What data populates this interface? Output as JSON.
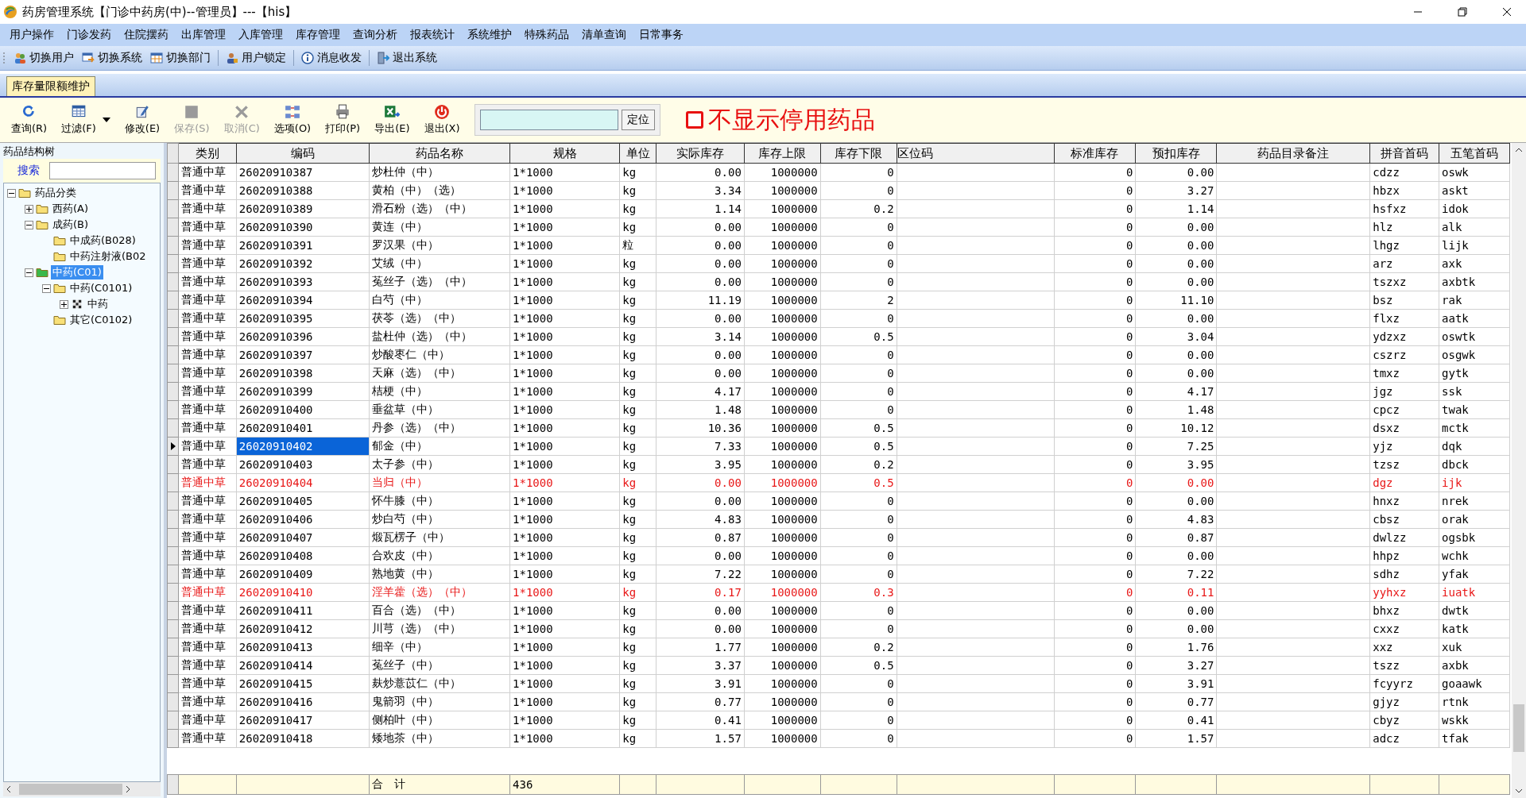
{
  "window": {
    "title": "药房管理系统【门诊中药房(中)--管理员】---【his】"
  },
  "menu": [
    "用户操作",
    "门诊发药",
    "住院摆药",
    "出库管理",
    "入库管理",
    "库存管理",
    "查询分析",
    "报表统计",
    "系统维护",
    "特殊药品",
    "清单查询",
    "日常事务"
  ],
  "toolbar": [
    "切换用户",
    "切换系统",
    "切换部门",
    "用户锁定",
    "消息收发",
    "退出系统"
  ],
  "tabs": [
    {
      "label": "库存量限额维护",
      "selected": true
    }
  ],
  "ribbon": [
    {
      "label": "查询(R)",
      "disabled": false
    },
    {
      "label": "过滤(F)",
      "disabled": false,
      "dropdown": true
    },
    {
      "label": "修改(E)",
      "disabled": false
    },
    {
      "label": "保存(S)",
      "disabled": true
    },
    {
      "label": "取消(C)",
      "disabled": true
    },
    {
      "label": "选项(O)",
      "disabled": false
    },
    {
      "label": "打印(P)",
      "disabled": false
    },
    {
      "label": "导出(E)",
      "disabled": false
    },
    {
      "label": "退出(X)",
      "disabled": false
    }
  ],
  "locate_button": "定位",
  "hide_disabled": {
    "label": "不显示停用药品",
    "checked": false
  },
  "sidebar": {
    "title": "药品结构树",
    "search_label": "搜索",
    "tree": [
      {
        "label": "药品分类",
        "kind": "folder",
        "selected": false,
        "expanded": true,
        "children": [
          {
            "label": "西药(A)",
            "kind": "folder",
            "selected": false,
            "expanded": false
          },
          {
            "label": "成药(B)",
            "kind": "folder",
            "selected": false,
            "expanded": true,
            "children": [
              {
                "label": "中成药(B028)",
                "kind": "folder",
                "selected": false
              },
              {
                "label": "中药注射液(B02",
                "kind": "folder",
                "selected": false
              }
            ]
          },
          {
            "label": "中药(C01)",
            "kind": "folder",
            "selected": true,
            "expanded": true,
            "children": [
              {
                "label": "中药(C0101)",
                "kind": "folder",
                "selected": false,
                "expanded": true,
                "children": [
                  {
                    "label": "中药",
                    "kind": "flag",
                    "selected": false,
                    "expanded": false
                  }
                ]
              },
              {
                "label": "其它(C0102)",
                "kind": "folder",
                "selected": false
              }
            ]
          }
        ]
      }
    ]
  },
  "table": {
    "columns": [
      "类别",
      "编码",
      "药品名称",
      "规格",
      "单位",
      "实际库存",
      "库存上限",
      "库存下限",
      "区位码",
      "标准库存",
      "预扣库存",
      "药品目录备注",
      "拼音首码",
      "五笔首码"
    ],
    "rows": [
      {
        "category": "普通中草",
        "code": "26020910387",
        "name": "炒杜仲（中）",
        "spec": "1*1000",
        "unit": "kg",
        "actual_stock": "0.00",
        "upper_limit": "1000000",
        "lower_limit": "0",
        "standard_stock": "0",
        "reserved_stock": "0.00",
        "pinyin_code": "cdzz",
        "wubi_code": "oswk",
        "alert": false,
        "selected": false
      },
      {
        "category": "普通中草",
        "code": "26020910388",
        "name": "黄柏（中）（选）",
        "spec": "1*1000",
        "unit": "kg",
        "actual_stock": "3.34",
        "upper_limit": "1000000",
        "lower_limit": "0",
        "standard_stock": "0",
        "reserved_stock": "3.27",
        "pinyin_code": "hbzx",
        "wubi_code": "askt",
        "alert": false,
        "selected": false
      },
      {
        "category": "普通中草",
        "code": "26020910389",
        "name": "滑石粉（选）（中）",
        "spec": "1*1000",
        "unit": "kg",
        "actual_stock": "1.14",
        "upper_limit": "1000000",
        "lower_limit": "0.2",
        "standard_stock": "0",
        "reserved_stock": "1.14",
        "pinyin_code": "hsfxz",
        "wubi_code": "idok",
        "alert": false,
        "selected": false
      },
      {
        "category": "普通中草",
        "code": "26020910390",
        "name": "黄连（中）",
        "spec": "1*1000",
        "unit": "kg",
        "actual_stock": "0.00",
        "upper_limit": "1000000",
        "lower_limit": "0",
        "standard_stock": "0",
        "reserved_stock": "0.00",
        "pinyin_code": "hlz",
        "wubi_code": "alk",
        "alert": false,
        "selected": false
      },
      {
        "category": "普通中草",
        "code": "26020910391",
        "name": "罗汉果（中）",
        "spec": "1*1000",
        "unit": "粒",
        "actual_stock": "0.00",
        "upper_limit": "1000000",
        "lower_limit": "0",
        "standard_stock": "0",
        "reserved_stock": "0.00",
        "pinyin_code": "lhgz",
        "wubi_code": "lijk",
        "alert": false,
        "selected": false
      },
      {
        "category": "普通中草",
        "code": "26020910392",
        "name": "艾绒（中）",
        "spec": "1*1000",
        "unit": "kg",
        "actual_stock": "0.00",
        "upper_limit": "1000000",
        "lower_limit": "0",
        "standard_stock": "0",
        "reserved_stock": "0.00",
        "pinyin_code": "arz",
        "wubi_code": "axk",
        "alert": false,
        "selected": false
      },
      {
        "category": "普通中草",
        "code": "26020910393",
        "name": "菟丝子（选）（中）",
        "spec": "1*1000",
        "unit": "kg",
        "actual_stock": "0.00",
        "upper_limit": "1000000",
        "lower_limit": "0",
        "standard_stock": "0",
        "reserved_stock": "0.00",
        "pinyin_code": "tszxz",
        "wubi_code": "axbtk",
        "alert": false,
        "selected": false
      },
      {
        "category": "普通中草",
        "code": "26020910394",
        "name": "白芍（中）",
        "spec": "1*1000",
        "unit": "kg",
        "actual_stock": "11.19",
        "upper_limit": "1000000",
        "lower_limit": "2",
        "standard_stock": "0",
        "reserved_stock": "11.10",
        "pinyin_code": "bsz",
        "wubi_code": "rak",
        "alert": false,
        "selected": false
      },
      {
        "category": "普通中草",
        "code": "26020910395",
        "name": "茯苓（选）（中）",
        "spec": "1*1000",
        "unit": "kg",
        "actual_stock": "0.00",
        "upper_limit": "1000000",
        "lower_limit": "0",
        "standard_stock": "0",
        "reserved_stock": "0.00",
        "pinyin_code": "flxz",
        "wubi_code": "aatk",
        "alert": false,
        "selected": false
      },
      {
        "category": "普通中草",
        "code": "26020910396",
        "name": "盐杜仲（选）（中）",
        "spec": "1*1000",
        "unit": "kg",
        "actual_stock": "3.14",
        "upper_limit": "1000000",
        "lower_limit": "0.5",
        "standard_stock": "0",
        "reserved_stock": "3.04",
        "pinyin_code": "ydzxz",
        "wubi_code": "oswtk",
        "alert": false,
        "selected": false
      },
      {
        "category": "普通中草",
        "code": "26020910397",
        "name": "炒酸枣仁（中）",
        "spec": "1*1000",
        "unit": "kg",
        "actual_stock": "0.00",
        "upper_limit": "1000000",
        "lower_limit": "0",
        "standard_stock": "0",
        "reserved_stock": "0.00",
        "pinyin_code": "cszrz",
        "wubi_code": "osgwk",
        "alert": false,
        "selected": false
      },
      {
        "category": "普通中草",
        "code": "26020910398",
        "name": "天麻（选）（中）",
        "spec": "1*1000",
        "unit": "kg",
        "actual_stock": "0.00",
        "upper_limit": "1000000",
        "lower_limit": "0",
        "standard_stock": "0",
        "reserved_stock": "0.00",
        "pinyin_code": "tmxz",
        "wubi_code": "gytk",
        "alert": false,
        "selected": false
      },
      {
        "category": "普通中草",
        "code": "26020910399",
        "name": "桔梗（中）",
        "spec": "1*1000",
        "unit": "kg",
        "actual_stock": "4.17",
        "upper_limit": "1000000",
        "lower_limit": "0",
        "standard_stock": "0",
        "reserved_stock": "4.17",
        "pinyin_code": "jgz",
        "wubi_code": "ssk",
        "alert": false,
        "selected": false
      },
      {
        "category": "普通中草",
        "code": "26020910400",
        "name": "垂盆草（中）",
        "spec": "1*1000",
        "unit": "kg",
        "actual_stock": "1.48",
        "upper_limit": "1000000",
        "lower_limit": "0",
        "standard_stock": "0",
        "reserved_stock": "1.48",
        "pinyin_code": "cpcz",
        "wubi_code": "twak",
        "alert": false,
        "selected": false
      },
      {
        "category": "普通中草",
        "code": "26020910401",
        "name": "丹参（选）（中）",
        "spec": "1*1000",
        "unit": "kg",
        "actual_stock": "10.36",
        "upper_limit": "1000000",
        "lower_limit": "0.5",
        "standard_stock": "0",
        "reserved_stock": "10.12",
        "pinyin_code": "dsxz",
        "wubi_code": "mctk",
        "alert": false,
        "selected": false
      },
      {
        "category": "普通中草",
        "code": "26020910402",
        "name": "郁金（中）",
        "spec": "1*1000",
        "unit": "kg",
        "actual_stock": "7.33",
        "upper_limit": "1000000",
        "lower_limit": "0.5",
        "standard_stock": "0",
        "reserved_stock": "7.25",
        "pinyin_code": "yjz",
        "wubi_code": "dqk",
        "alert": false,
        "selected": true
      },
      {
        "category": "普通中草",
        "code": "26020910403",
        "name": "太子参（中）",
        "spec": "1*1000",
        "unit": "kg",
        "actual_stock": "3.95",
        "upper_limit": "1000000",
        "lower_limit": "0.2",
        "standard_stock": "0",
        "reserved_stock": "3.95",
        "pinyin_code": "tzsz",
        "wubi_code": "dbck",
        "alert": false,
        "selected": false
      },
      {
        "category": "普通中草",
        "code": "26020910404",
        "name": "当归（中）",
        "spec": "1*1000",
        "unit": "kg",
        "actual_stock": "0.00",
        "upper_limit": "1000000",
        "lower_limit": "0.5",
        "standard_stock": "0",
        "reserved_stock": "0.00",
        "pinyin_code": "dgz",
        "wubi_code": "ijk",
        "alert": true,
        "selected": false
      },
      {
        "category": "普通中草",
        "code": "26020910405",
        "name": "怀牛膝（中）",
        "spec": "1*1000",
        "unit": "kg",
        "actual_stock": "0.00",
        "upper_limit": "1000000",
        "lower_limit": "0",
        "standard_stock": "0",
        "reserved_stock": "0.00",
        "pinyin_code": "hnxz",
        "wubi_code": "nrek",
        "alert": false,
        "selected": false
      },
      {
        "category": "普通中草",
        "code": "26020910406",
        "name": "炒白芍（中）",
        "spec": "1*1000",
        "unit": "kg",
        "actual_stock": "4.83",
        "upper_limit": "1000000",
        "lower_limit": "0",
        "standard_stock": "0",
        "reserved_stock": "4.83",
        "pinyin_code": "cbsz",
        "wubi_code": "orak",
        "alert": false,
        "selected": false
      },
      {
        "category": "普通中草",
        "code": "26020910407",
        "name": "煅瓦楞子（中）",
        "spec": "1*1000",
        "unit": "kg",
        "actual_stock": "0.87",
        "upper_limit": "1000000",
        "lower_limit": "0",
        "standard_stock": "0",
        "reserved_stock": "0.87",
        "pinyin_code": "dwlzz",
        "wubi_code": "ogsbk",
        "alert": false,
        "selected": false
      },
      {
        "category": "普通中草",
        "code": "26020910408",
        "name": "合欢皮（中）",
        "spec": "1*1000",
        "unit": "kg",
        "actual_stock": "0.00",
        "upper_limit": "1000000",
        "lower_limit": "0",
        "standard_stock": "0",
        "reserved_stock": "0.00",
        "pinyin_code": "hhpz",
        "wubi_code": "wchk",
        "alert": false,
        "selected": false
      },
      {
        "category": "普通中草",
        "code": "26020910409",
        "name": "熟地黄（中）",
        "spec": "1*1000",
        "unit": "kg",
        "actual_stock": "7.22",
        "upper_limit": "1000000",
        "lower_limit": "0",
        "standard_stock": "0",
        "reserved_stock": "7.22",
        "pinyin_code": "sdhz",
        "wubi_code": "yfak",
        "alert": false,
        "selected": false
      },
      {
        "category": "普通中草",
        "code": "26020910410",
        "name": "淫羊藿（选）（中）",
        "spec": "1*1000",
        "unit": "kg",
        "actual_stock": "0.17",
        "upper_limit": "1000000",
        "lower_limit": "0.3",
        "standard_stock": "0",
        "reserved_stock": "0.11",
        "pinyin_code": "yyhxz",
        "wubi_code": "iuatk",
        "alert": true,
        "selected": false
      },
      {
        "category": "普通中草",
        "code": "26020910411",
        "name": "百合（选）（中）",
        "spec": "1*1000",
        "unit": "kg",
        "actual_stock": "0.00",
        "upper_limit": "1000000",
        "lower_limit": "0",
        "standard_stock": "0",
        "reserved_stock": "0.00",
        "pinyin_code": "bhxz",
        "wubi_code": "dwtk",
        "alert": false,
        "selected": false
      },
      {
        "category": "普通中草",
        "code": "26020910412",
        "name": "川芎（选）（中）",
        "spec": "1*1000",
        "unit": "kg",
        "actual_stock": "0.00",
        "upper_limit": "1000000",
        "lower_limit": "0",
        "standard_stock": "0",
        "reserved_stock": "0.00",
        "pinyin_code": "cxxz",
        "wubi_code": "katk",
        "alert": false,
        "selected": false
      },
      {
        "category": "普通中草",
        "code": "26020910413",
        "name": "细辛（中）",
        "spec": "1*1000",
        "unit": "kg",
        "actual_stock": "1.77",
        "upper_limit": "1000000",
        "lower_limit": "0.2",
        "standard_stock": "0",
        "reserved_stock": "1.76",
        "pinyin_code": "xxz",
        "wubi_code": "xuk",
        "alert": false,
        "selected": false
      },
      {
        "category": "普通中草",
        "code": "26020910414",
        "name": "菟丝子（中）",
        "spec": "1*1000",
        "unit": "kg",
        "actual_stock": "3.37",
        "upper_limit": "1000000",
        "lower_limit": "0.5",
        "standard_stock": "0",
        "reserved_stock": "3.27",
        "pinyin_code": "tszz",
        "wubi_code": "axbk",
        "alert": false,
        "selected": false
      },
      {
        "category": "普通中草",
        "code": "26020910415",
        "name": "麸炒薏苡仁（中）",
        "spec": "1*1000",
        "unit": "kg",
        "actual_stock": "3.91",
        "upper_limit": "1000000",
        "lower_limit": "0",
        "standard_stock": "0",
        "reserved_stock": "3.91",
        "pinyin_code": "fcyyrz",
        "wubi_code": "goaawk",
        "alert": false,
        "selected": false
      },
      {
        "category": "普通中草",
        "code": "26020910416",
        "name": "鬼箭羽（中）",
        "spec": "1*1000",
        "unit": "kg",
        "actual_stock": "0.77",
        "upper_limit": "1000000",
        "lower_limit": "0",
        "standard_stock": "0",
        "reserved_stock": "0.77",
        "pinyin_code": "gjyz",
        "wubi_code": "rtnk",
        "alert": false,
        "selected": false
      },
      {
        "category": "普通中草",
        "code": "26020910417",
        "name": "侧柏叶（中）",
        "spec": "1*1000",
        "unit": "kg",
        "actual_stock": "0.41",
        "upper_limit": "1000000",
        "lower_limit": "0",
        "standard_stock": "0",
        "reserved_stock": "0.41",
        "pinyin_code": "cbyz",
        "wubi_code": "wskk",
        "alert": false,
        "selected": false
      },
      {
        "category": "普通中草",
        "code": "26020910418",
        "name": "矮地茶（中）",
        "spec": "1*1000",
        "unit": "kg",
        "actual_stock": "1.57",
        "upper_limit": "1000000",
        "lower_limit": "0",
        "standard_stock": "0",
        "reserved_stock": "1.57",
        "pinyin_code": "adcz",
        "wubi_code": "tfak",
        "alert": false,
        "selected": false
      }
    ],
    "footer": {
      "label": "合　计",
      "count": "436"
    }
  }
}
